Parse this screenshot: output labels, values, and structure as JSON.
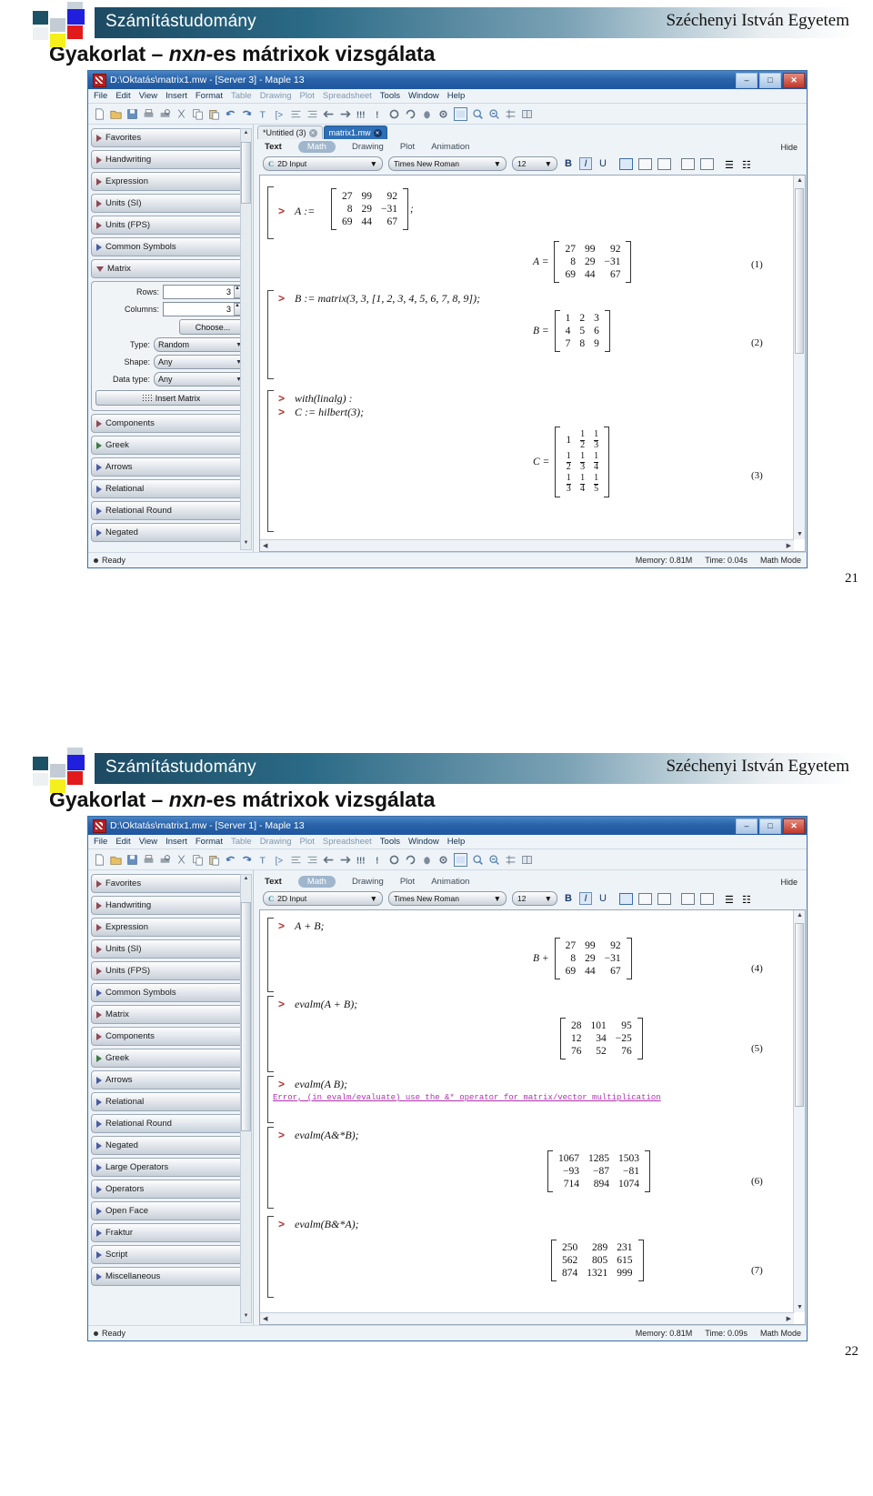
{
  "slides": [
    {
      "header": {
        "brand": "Számítástudomány",
        "university": "Széchenyi István Egyetem"
      },
      "title_prefix": "Gyakorlat – ",
      "title_italic": "n",
      "title_x": "x",
      "title_italic2": "n",
      "title_suffix": "-es mátrixok vizsgálata",
      "page_number": "21",
      "window": {
        "title": "D:\\Oktatás\\matrix1.mw - [Server 3] - Maple 13",
        "minimize": "–",
        "maximize": "□",
        "close": "✕",
        "menus": [
          "File",
          "Edit",
          "View",
          "Insert",
          "Format",
          "Table",
          "Drawing",
          "Plot",
          "Spreadsheet",
          "Tools",
          "Window",
          "Help"
        ],
        "dim_menus": [
          "Table",
          "Drawing",
          "Plot",
          "Spreadsheet"
        ]
      },
      "palette": {
        "items": [
          "Favorites",
          "Handwriting",
          "Expression",
          "Units (SI)",
          "Units (FPS)",
          "Common Symbols"
        ],
        "matrix_label": "Matrix",
        "rows_label": "Rows:",
        "rows_value": "3",
        "cols_label": "Columns:",
        "cols_value": "3",
        "choose_label": "Choose...",
        "type_label": "Type:",
        "type_value": "Random",
        "shape_label": "Shape:",
        "shape_value": "Any",
        "datatype_label": "Data type:",
        "datatype_value": "Any",
        "insert_label": "Insert Matrix",
        "items_after": [
          "Components",
          "Greek",
          "Arrows",
          "Relational",
          "Relational Round",
          "Negated"
        ]
      },
      "tabs": [
        {
          "label": "*Untitled (3)",
          "active": false,
          "close": "✕"
        },
        {
          "label": "matrix1.mw",
          "active": true,
          "close": "✕"
        }
      ],
      "modes": [
        "Text",
        "Math",
        "Drawing",
        "Plot",
        "Animation"
      ],
      "active_mode": "Math",
      "hide_label": "Hide",
      "fontbar": {
        "input_mode": "2D Input",
        "font": "Times New Roman",
        "size": "12",
        "bold": "B",
        "italic": "I",
        "underline": "U"
      },
      "content": {
        "line1_prompt": ">",
        "line1_label": "A :=",
        "line1_semi": ";",
        "matrixA": [
          [
            "27",
            "99",
            "92"
          ],
          [
            "8",
            "29",
            "−31"
          ],
          [
            "69",
            "44",
            "67"
          ]
        ],
        "out1_label": "A =",
        "out1_num": "(1)",
        "line2_prompt": ">",
        "line2_code": "B := matrix(3, 3, [1, 2, 3, 4, 5, 6, 7, 8, 9]);",
        "matrixB": [
          [
            "1",
            "2",
            "3"
          ],
          [
            "4",
            "5",
            "6"
          ],
          [
            "7",
            "8",
            "9"
          ]
        ],
        "out2_label": "B =",
        "out2_num": "(2)",
        "line3_prompt": ">",
        "line3_code": "with(linalg) :",
        "line4_prompt": ">",
        "line4_code": "C := hilbert(3);",
        "matrixC": [
          [
            "1",
            "1/2",
            "1/3"
          ],
          [
            "1/2",
            "1/3",
            "1/4"
          ],
          [
            "1/3",
            "1/4",
            "1/5"
          ]
        ],
        "out3_label": "C =",
        "out3_num": "(3)",
        "line5_prompt": ">"
      },
      "status": {
        "ready": "Ready",
        "memory": "Memory: 0.81M",
        "time": "Time: 0.04s",
        "mode": "Math Mode"
      }
    },
    {
      "header": {
        "brand": "Számítástudomány",
        "university": "Széchenyi István Egyetem"
      },
      "title_prefix": "Gyakorlat – ",
      "title_italic": "n",
      "title_x": "x",
      "title_italic2": "n",
      "title_suffix": "-es mátrixok vizsgálata",
      "page_number": "22",
      "window": {
        "title": "D:\\Oktatás\\matrix1.mw - [Server 1] - Maple 13",
        "minimize": "–",
        "maximize": "□",
        "close": "✕",
        "menus": [
          "File",
          "Edit",
          "View",
          "Insert",
          "Format",
          "Table",
          "Drawing",
          "Plot",
          "Spreadsheet",
          "Tools",
          "Window",
          "Help"
        ],
        "dim_menus": [
          "Table",
          "Drawing",
          "Plot",
          "Spreadsheet"
        ]
      },
      "palette": {
        "items": [
          "Favorites",
          "Handwriting",
          "Expression",
          "Units (SI)",
          "Units (FPS)",
          "Common Symbols",
          "Matrix",
          "Components",
          "Greek",
          "Arrows",
          "Relational",
          "Relational Round",
          "Negated",
          "Large Operators",
          "Operators",
          "Open Face",
          "Fraktur",
          "Script",
          "Miscellaneous"
        ]
      },
      "modes": [
        "Text",
        "Math",
        "Drawing",
        "Plot",
        "Animation"
      ],
      "active_mode": "Math",
      "hide_label": "Hide",
      "fontbar": {
        "input_mode": "2D Input",
        "font": "Times New Roman",
        "size": "12",
        "bold": "B",
        "italic": "I",
        "underline": "U"
      },
      "content": {
        "line1_prompt": ">",
        "line1_code": "A + B;",
        "out4_label": "B +",
        "out4_num": "(4)",
        "matrix4": [
          [
            "27",
            "99",
            "92"
          ],
          [
            "8",
            "29",
            "−31"
          ],
          [
            "69",
            "44",
            "67"
          ]
        ],
        "line2_prompt": ">",
        "line2_code": "evalm(A + B);",
        "matrix5": [
          [
            "28",
            "101",
            "95"
          ],
          [
            "12",
            "34",
            "−25"
          ],
          [
            "76",
            "52",
            "76"
          ]
        ],
        "out5_num": "(5)",
        "line3_prompt": ">",
        "line3_code": "evalm(A B);",
        "error_text": "Error, (in evalm/evaluate) use the &* operator for matrix/vector multiplication",
        "line4_prompt": ">",
        "line4_code": "evalm(A&*B);",
        "matrix6": [
          [
            "1067",
            "1285",
            "1503"
          ],
          [
            "−93",
            "−87",
            "−81"
          ],
          [
            "714",
            "894",
            "1074"
          ]
        ],
        "out6_num": "(6)",
        "line5_prompt": ">",
        "line5_code": "evalm(B&*A);",
        "matrix7": [
          [
            "250",
            "289",
            "231"
          ],
          [
            "562",
            "805",
            "615"
          ],
          [
            "874",
            "1321",
            "999"
          ]
        ],
        "out7_num": "(7)"
      },
      "status": {
        "ready": "Ready",
        "memory": "Memory: 0.81M",
        "time": "Time: 0.09s",
        "mode": "Math Mode"
      }
    }
  ]
}
